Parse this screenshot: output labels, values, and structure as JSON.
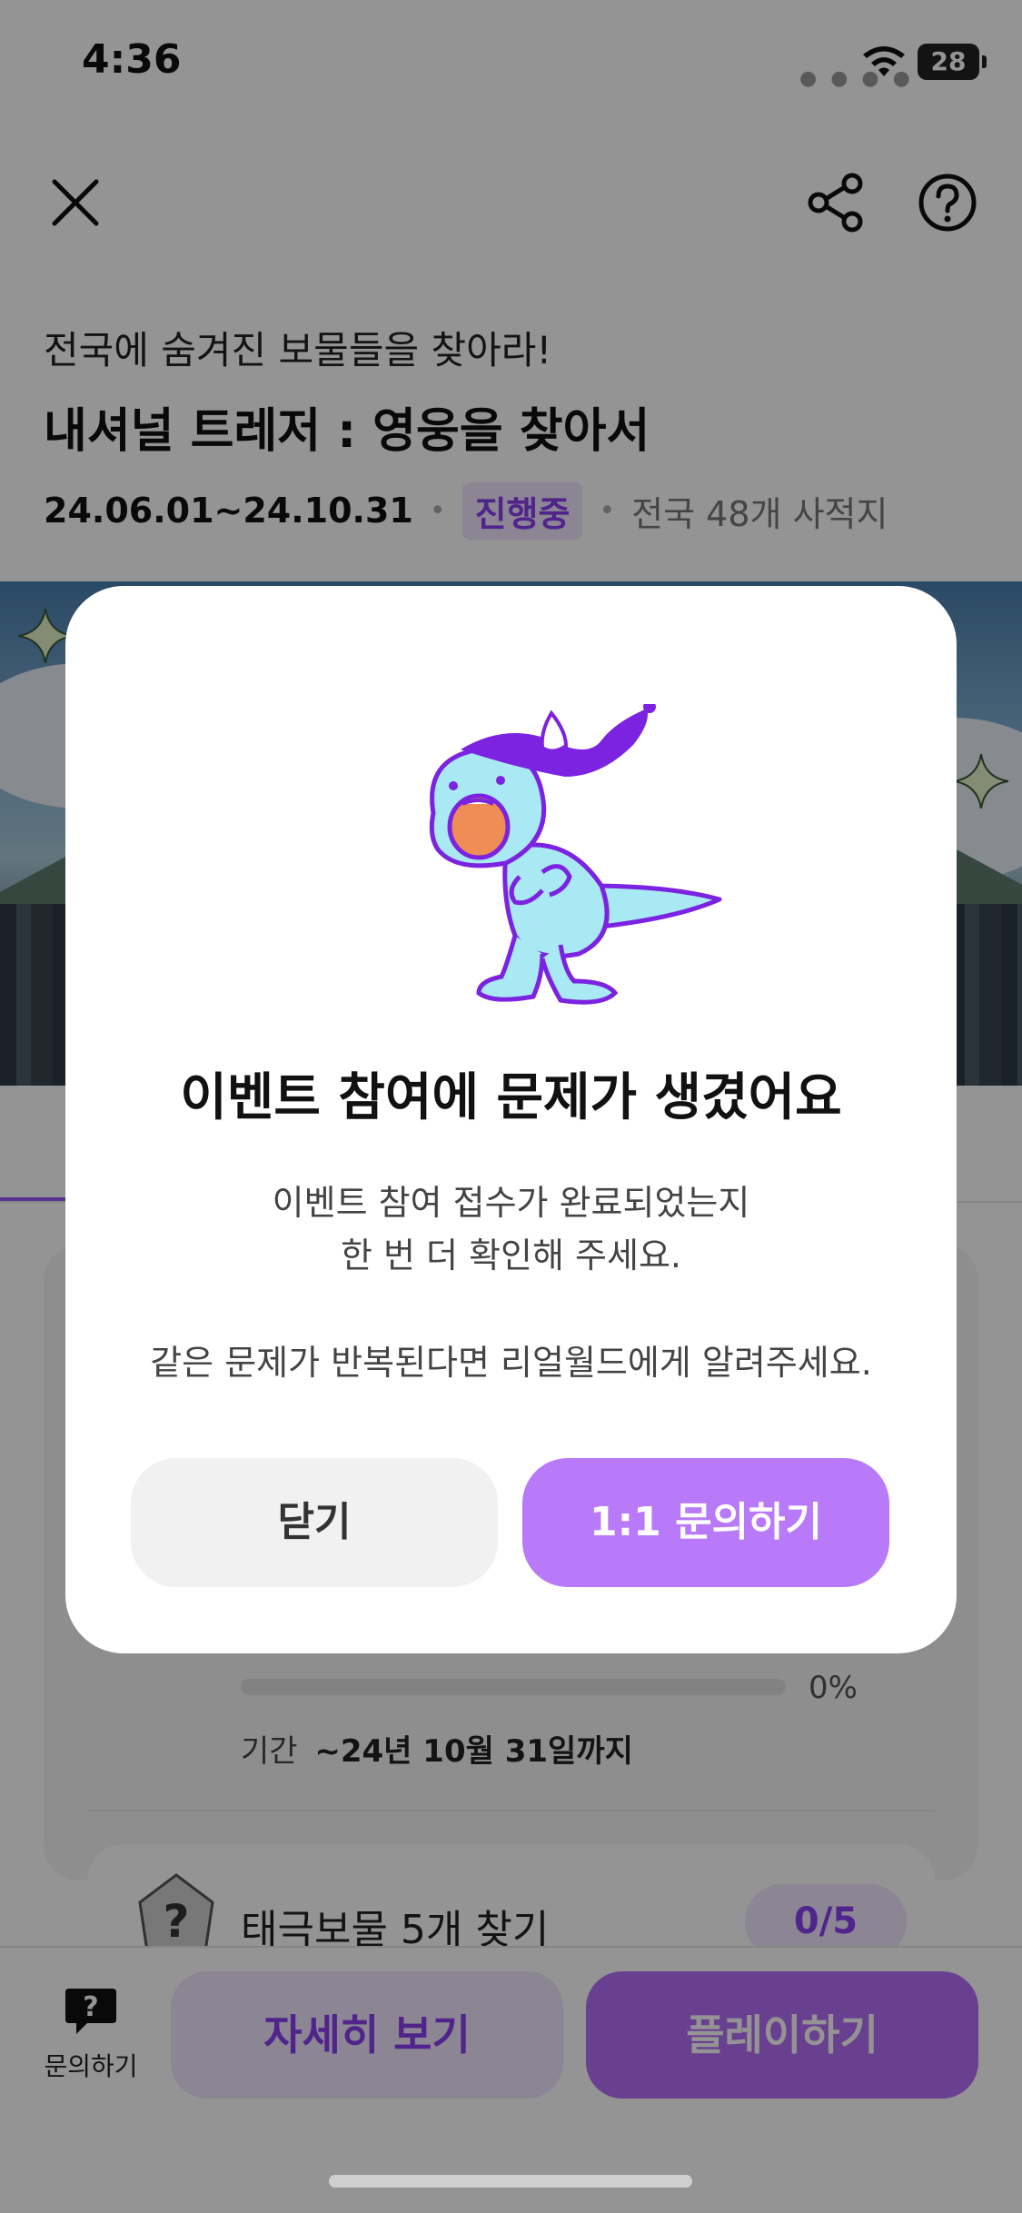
{
  "status_bar": {
    "time": "4:36",
    "battery": "28"
  },
  "header": {
    "subtitle": "전국에 숨겨진 보물들을 찾아라!",
    "title": "내셔널 트레저 : 영웅을 찾아서",
    "date_range": "24.06.01~24.10.31",
    "status": "진행중",
    "location": "전국 48개 사적지"
  },
  "mission": {
    "progress_text": "0%",
    "progress_fraction": 0,
    "period_label": "기간",
    "period_value": "~24년 10월 31일까지",
    "label": "태극보물 5개 찾기",
    "count": "0/5"
  },
  "bottom_bar": {
    "inquiry_label": "문의하기",
    "detail_label": "자세히 보기",
    "play_label": "플레이하기"
  },
  "modal": {
    "title": "이벤트 참여에 문제가 생겼어요",
    "body_line1": "이벤트 참여 접수가 완료되었는지",
    "body_line2": "한 번 더 확인해 주세요.",
    "body_line3": "같은 문제가 반복된다면 리얼월드에게 알려주세요.",
    "close_label": "닫기",
    "inquiry_label": "1:1 문의하기"
  },
  "colors": {
    "accent": "#b87af8",
    "accent_dark": "#8b3ff0",
    "accent_light": "#efe6ff"
  },
  "icons": [
    "close-icon",
    "share-icon",
    "help-icon",
    "wifi-icon",
    "question-bubble-icon",
    "mission-gem-icon",
    "mascot-illustration"
  ]
}
